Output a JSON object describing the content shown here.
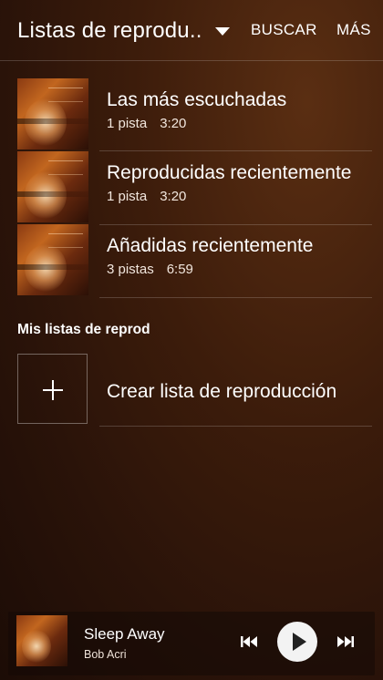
{
  "header": {
    "title": "Listas de reprodu..",
    "search_label": "BUSCAR",
    "more_label": "MÁS"
  },
  "playlists": [
    {
      "title": "Las más escuchadas",
      "tracks": "1 pista",
      "duration": "3:20"
    },
    {
      "title": "Reproducidas recientemente",
      "tracks": "1 pista",
      "duration": "3:20"
    },
    {
      "title": "Añadidas recientemente",
      "tracks": "3 pistas",
      "duration": "6:59"
    }
  ],
  "my_playlists": {
    "section_title": "Mis listas de reprod",
    "create_label": "Crear lista de reproducción"
  },
  "now_playing": {
    "title": "Sleep Away",
    "artist": "Bob Acri"
  }
}
